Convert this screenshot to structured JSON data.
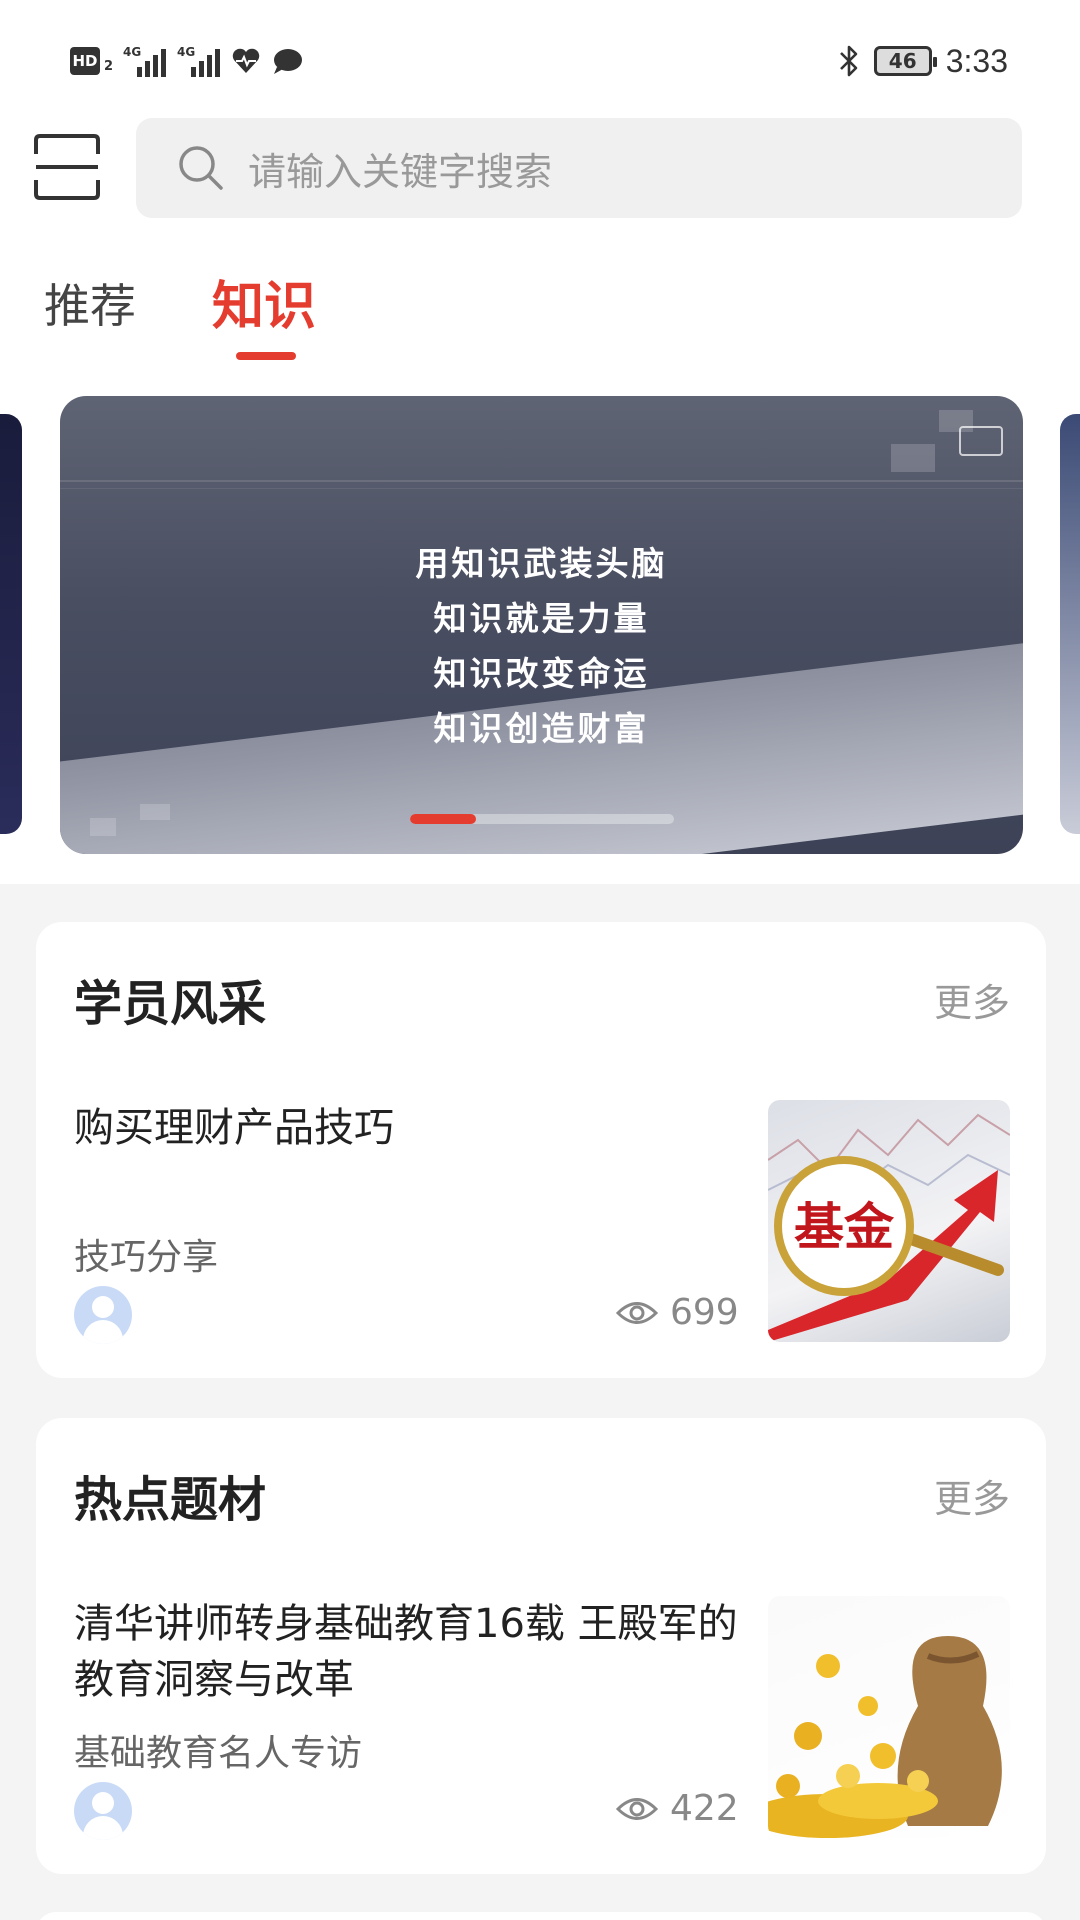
{
  "status_bar": {
    "hd_label": "HD",
    "hd_sub": "2",
    "signal1_tag": "4G",
    "signal2_tag": "4G",
    "battery_level": "46",
    "time": "3:33"
  },
  "search": {
    "placeholder": "请输入关键字搜索"
  },
  "tabs": [
    {
      "label": "推荐",
      "active": false
    },
    {
      "label": "知识",
      "active": true
    }
  ],
  "banner": {
    "lines": [
      "用知识武装头脑",
      "知识就是力量",
      "知识改变命运",
      "知识创造财富"
    ],
    "active_slide_fraction": 0.25
  },
  "sections": [
    {
      "title": "学员风采",
      "more_label": "更多",
      "item": {
        "title": "购买理财产品技巧",
        "subtitle": "技巧分享",
        "views": "699",
        "thumb_text": "基金"
      }
    },
    {
      "title": "热点题材",
      "more_label": "更多",
      "item": {
        "title": "清华讲师转身基础教育16载 王殿军的教育洞察与改革",
        "subtitle": "基础教育名人专访",
        "views": "422"
      }
    }
  ],
  "colors": {
    "accent": "#e43d2f",
    "background": "#f4f4f5"
  }
}
